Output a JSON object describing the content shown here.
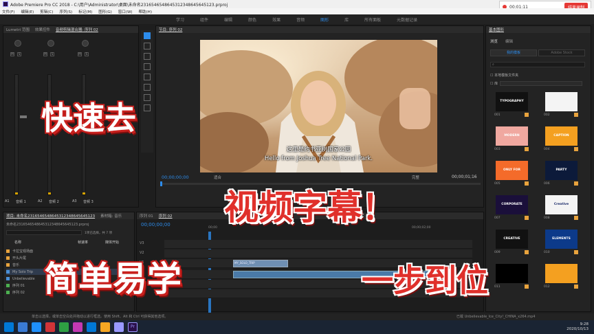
{
  "window": {
    "title": "Adobe Premiere Pro CC 2018 - C:\\用户\\Administrator\\桌面\\未命名2316546548645312348645645123.prproj",
    "controls": [
      "—",
      "☐",
      "✕"
    ]
  },
  "menu": [
    "文件(F)",
    "编辑(E)",
    "剪辑(C)",
    "序列(S)",
    "标记(M)",
    "图形(G)",
    "窗口(W)",
    "帮助(H)"
  ],
  "workspaces": [
    {
      "label": "学习",
      "active": false
    },
    {
      "label": "组件",
      "active": false
    },
    {
      "label": "编辑",
      "active": false
    },
    {
      "label": "颜色",
      "active": false
    },
    {
      "label": "效果",
      "active": false
    },
    {
      "label": "音频",
      "active": false
    },
    {
      "label": "图形",
      "active": true
    },
    {
      "label": "库",
      "active": false
    },
    {
      "label": "所有面板",
      "active": false
    },
    {
      "label": "元数据记录",
      "active": false
    }
  ],
  "recorder": {
    "time": "00:01:11",
    "button": "结束录制"
  },
  "mixer": {
    "tabs": [
      "Lumetri 范围",
      "效果控件",
      "音频剪辑混合器: 序列 02"
    ],
    "channels": [
      {
        "id": "A1",
        "name": "音频 1"
      },
      {
        "id": "A2",
        "name": "音频 2"
      },
      {
        "id": "A3",
        "name": "音频 3"
      }
    ],
    "buttons": [
      "M",
      "S"
    ]
  },
  "program": {
    "tab": "节目: 序列 02",
    "timecode_in": "00;00;00;00",
    "fit": "适合",
    "quality": "完整",
    "timecode_out": "00;00;01;16",
    "subtitle_cn": "这里是约书亚树国家公园",
    "subtitle_en": "Hello from Joshua Tree National Park."
  },
  "project": {
    "tabs": [
      "项目: 未命名2316546548645312348645645123",
      "素材箱: 音乐"
    ],
    "path": "未命名2316546548645312348645645123.prproj",
    "selection": "1项已选择，共 7 项",
    "columns": [
      "名称",
      "帧速率",
      "媒体开始"
    ],
    "items": [
      {
        "name": "卡拉宝观场面",
        "color": "#e8a33d"
      },
      {
        "name": "开头片尾",
        "color": "#e8a33d"
      },
      {
        "name": "音乐",
        "color": "#e8a33d"
      },
      {
        "name": "My Solo Trip",
        "color": "#4a8fd6"
      },
      {
        "name": "Unbelievable",
        "color": "#4a8fd6"
      },
      {
        "name": "序列 01",
        "color": "#4caf50"
      },
      {
        "name": "序列 02",
        "color": "#4caf50"
      }
    ]
  },
  "timeline": {
    "tabs": [
      "序列 01",
      "序列 02"
    ],
    "timecode": "00;00;00;00",
    "ruler": [
      "00;00",
      "00;00;02;00"
    ],
    "tracks": [
      "V3",
      "V2",
      "V1",
      "A1",
      "A2",
      "A3"
    ],
    "clip_label": "MY_SOLO_TRIP"
  },
  "graphics": {
    "panel_title": "基本图形",
    "tabs": [
      "浏览",
      "编辑"
    ],
    "scope_tabs": [
      "我的模板",
      "Adobe Stock"
    ],
    "checkbox_label": "本地模板文件夹",
    "library_label": "库",
    "templates": [
      {
        "num": "001",
        "label": "TYPOGRAPHY",
        "bg": "#111111",
        "fg": "#ffffff"
      },
      {
        "num": "002",
        "label": "",
        "bg": "#f4f4f4",
        "fg": "#111111"
      },
      {
        "num": "003",
        "label": "MODERN",
        "bg": "#f0a8a0",
        "fg": "#ffffff"
      },
      {
        "num": "004",
        "label": "CAPTION",
        "bg": "#f4a020",
        "fg": "#ffffff"
      },
      {
        "num": "005",
        "label": "ONLY FOR",
        "bg": "#f46b2a",
        "fg": "#ffffff"
      },
      {
        "num": "006",
        "label": "PARTY",
        "bg": "#0c1a3a",
        "fg": "#ffffff"
      },
      {
        "num": "007",
        "label": "CORPORATE",
        "bg": "#1a0f3a",
        "fg": "#ffffff"
      },
      {
        "num": "008",
        "label": "Creative",
        "bg": "#f4f4f4",
        "fg": "#1a2a6a"
      },
      {
        "num": "009",
        "label": "CREATIVE",
        "bg": "#111111",
        "fg": "#ffffff"
      },
      {
        "num": "010",
        "label": "ELEMENTS",
        "bg": "#0c3a8a",
        "fg": "#ffffff"
      },
      {
        "num": "011",
        "label": "",
        "bg": "#000000",
        "fg": "#ffffff"
      },
      {
        "num": "012",
        "label": "",
        "bg": "#f4a020",
        "fg": "#ffffff"
      }
    ]
  },
  "status": {
    "hint": "单击以选择，或单击空白处并拖动以进行框选。使用 Shift、Alt 和 Ctrl 可获得其他选项。",
    "file": "已载 Unbelievable_Ice_City!_CHINA_x264.mp4"
  },
  "taskbar": {
    "apps": [
      "#3a7bd5",
      "#1e90ff",
      "#d13438",
      "#2ea043",
      "#c239b3",
      "#0078d7",
      "#f5a623",
      "#9999ff",
      "#5c2d91"
    ],
    "pr_label": "Pr",
    "time": "9:28",
    "date": "2020/10/13"
  },
  "overlay": {
    "line1": "快速去",
    "line2": "视频字幕！",
    "line3": "简单易学",
    "line4": "一步到位"
  }
}
